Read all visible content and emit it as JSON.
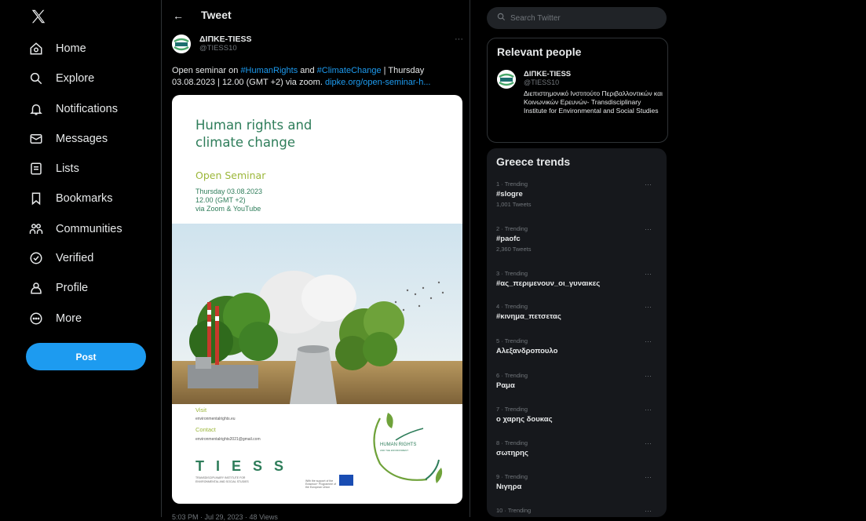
{
  "sidebar": {
    "logo": "X",
    "items": [
      {
        "label": "Home",
        "icon": "home-icon"
      },
      {
        "label": "Explore",
        "icon": "search-icon"
      },
      {
        "label": "Notifications",
        "icon": "bell-icon"
      },
      {
        "label": "Messages",
        "icon": "envelope-icon"
      },
      {
        "label": "Lists",
        "icon": "list-icon"
      },
      {
        "label": "Bookmarks",
        "icon": "bookmark-icon"
      },
      {
        "label": "Communities",
        "icon": "people-icon"
      },
      {
        "label": "Verified",
        "icon": "verified-icon"
      },
      {
        "label": "Profile",
        "icon": "person-icon"
      },
      {
        "label": "More",
        "icon": "more-circle-icon"
      }
    ],
    "post_label": "Post"
  },
  "header": {
    "back": "←",
    "title": "Tweet"
  },
  "tweet": {
    "author_name": "ΔΙΠΚΕ-TIESS",
    "author_handle": "@TIESS10",
    "avatar_text": "TIESS",
    "more": "···",
    "text_1": "Open seminar on ",
    "hashtag_1": "#HumanRights",
    "text_2": " and ",
    "hashtag_2": "#ClimateChange",
    "text_3": " | Thursday 03.08.2023 | 12.00 (GMT +2) via zoom. ",
    "link": "dipke.org/open-seminar-h...",
    "meta": "5:03 PM · Jul 29, 2023 · 48 Views",
    "poster": {
      "title_line1": "Human rights and",
      "title_line2": "climate change",
      "seminar": "Open Seminar",
      "date": "Thursday 03.08.2023",
      "time": "12.00  (GMT +2)",
      "via": "via Zoom & YouTube",
      "visit": "Visit",
      "visit_url": "environmentalrights.eu",
      "contact": "Contact",
      "contact_mail": "environmentalrights2021@gmail.com",
      "tiess": "T I E S S",
      "institute": "TRANSDISCIPLINARY INSTITUTE FOR ENVIRONMENTAL AND SOCIAL STUDIES",
      "eu_support": "With the support of the Erasmus+ Programme of the European Union",
      "logo_title": "HUMAN RIGHTS",
      "logo_sub": "AND THE ENVIRONMENT"
    }
  },
  "search": {
    "placeholder": "Search Twitter"
  },
  "relevant": {
    "title": "Relevant people",
    "name": "ΔΙΠΚΕ-TIESS",
    "handle": "@TIESS10",
    "bio": "Διεπιστημονικό Ινστιτούτο Περιβαλλοντικών και Κοινωνικών Ερευνών- Transdisciplinary Institute for Environmental and Social Studies"
  },
  "trends": {
    "title": "Greece trends",
    "items": [
      {
        "context": "1 · Trending",
        "name": "#slogre",
        "count": "1,001 Tweets"
      },
      {
        "context": "2 · Trending",
        "name": "#paofc",
        "count": "2,360 Tweets"
      },
      {
        "context": "3 · Trending",
        "name": "#ας_περιμενουν_οι_γυναικες",
        "count": ""
      },
      {
        "context": "4 · Trending",
        "name": "#κινημα_πετσετας",
        "count": ""
      },
      {
        "context": "5 · Trending",
        "name": "Αλεξανδροπουλο",
        "count": ""
      },
      {
        "context": "6 · Trending",
        "name": "Ραμα",
        "count": ""
      },
      {
        "context": "7 · Trending",
        "name": "ο χαρης δουκας",
        "count": ""
      },
      {
        "context": "8 · Trending",
        "name": "σωτηρης",
        "count": ""
      },
      {
        "context": "9 · Trending",
        "name": "Νιγηρα",
        "count": ""
      },
      {
        "context": "10 · Trending",
        "name": "",
        "count": ""
      }
    ],
    "more": "···"
  },
  "colors": {
    "accent": "#1d9bf0",
    "background": "#000000",
    "panel": "#16181c",
    "muted": "#71767b"
  }
}
